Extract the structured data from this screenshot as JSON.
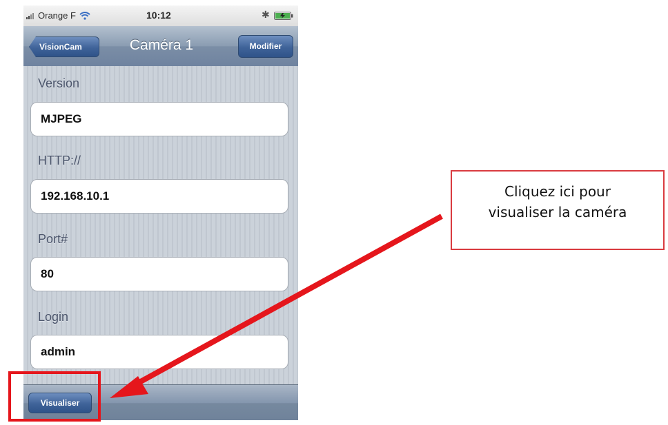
{
  "status_bar": {
    "carrier": "Orange F",
    "time": "10:12",
    "icons": [
      "signal-icon",
      "wifi-icon",
      "bluetooth-icon",
      "battery-icon"
    ]
  },
  "nav": {
    "back_label": "VisionCam",
    "title": "Caméra 1",
    "edit_label": "Modifier"
  },
  "form": {
    "fields": [
      {
        "label": "Version",
        "value": "MJPEG"
      },
      {
        "label": "HTTP://",
        "value": "192.168.10.1"
      },
      {
        "label": "Port#",
        "value": "80"
      },
      {
        "label": "Login",
        "value": "admin"
      }
    ]
  },
  "toolbar": {
    "view_label": "Visualiser"
  },
  "annotation": {
    "callout_line1": "Cliquez ici pour",
    "callout_line2": "visualiser la caméra",
    "color": "#e5161c"
  }
}
